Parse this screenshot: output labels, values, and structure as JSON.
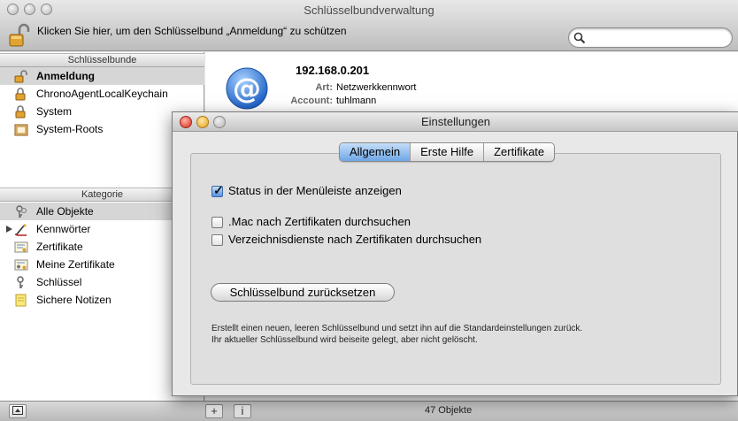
{
  "window": {
    "title": "Schlüsselbundverwaltung",
    "lock_text": "Klicken Sie hier, um den Schlüsselbund „Anmeldung“ zu schützen",
    "search_placeholder": ""
  },
  "sidebar": {
    "keychains_header": "Schlüsselbunde",
    "keychains": [
      {
        "label": "Anmeldung",
        "icon": "lock-open-icon",
        "selected": true
      },
      {
        "label": "ChronoAgentLocalKeychain",
        "icon": "lock-icon"
      },
      {
        "label": "System",
        "icon": "lock-icon"
      },
      {
        "label": "System-Roots",
        "icon": "folder-icon"
      }
    ],
    "category_header": "Kategorie",
    "categories": [
      {
        "label": "Alle Objekte",
        "icon": "all-items-icon",
        "selected": true
      },
      {
        "label": "Kennwörter",
        "icon": "passwords-icon",
        "expandable": true
      },
      {
        "label": "Zertifikate",
        "icon": "certificate-icon"
      },
      {
        "label": "Meine Zertifikate",
        "icon": "my-certificate-icon"
      },
      {
        "label": "Schlüssel",
        "icon": "key-icon"
      },
      {
        "label": "Sichere Notizen",
        "icon": "note-icon"
      }
    ]
  },
  "detail": {
    "title": "192.168.0.201",
    "kind_label": "Art:",
    "kind_value": "Netzwerkkennwort",
    "account_label": "Account:",
    "account_value": "tuhlmann"
  },
  "bottom": {
    "add_label": "+",
    "info_label": "i",
    "count": "47 Objekte"
  },
  "dialog": {
    "title": "Einstellungen",
    "tabs": [
      "Allgemein",
      "Erste Hilfe",
      "Zertifikate"
    ],
    "active_tab": 0,
    "options": [
      {
        "label": "Status in der Menüleiste anzeigen",
        "checked": true
      },
      {
        "label": ".Mac nach Zertifikaten durchsuchen",
        "checked": false
      },
      {
        "label": "Verzeichnisdienste nach Zertifikaten durchsuchen",
        "checked": false
      }
    ],
    "reset_button": "Schlüsselbund zurücksetzen",
    "help_line1": "Erstellt einen neuen, leeren Schlüsselbund und setzt ihn auf die Standardeinstellungen zurück.",
    "help_line2": "Ihr aktueller Schlüsselbund wird beiseite gelegt, aber nicht gelöscht."
  },
  "colors": {
    "selection": "#d6d6d6",
    "accent_blue": "#5592df"
  }
}
